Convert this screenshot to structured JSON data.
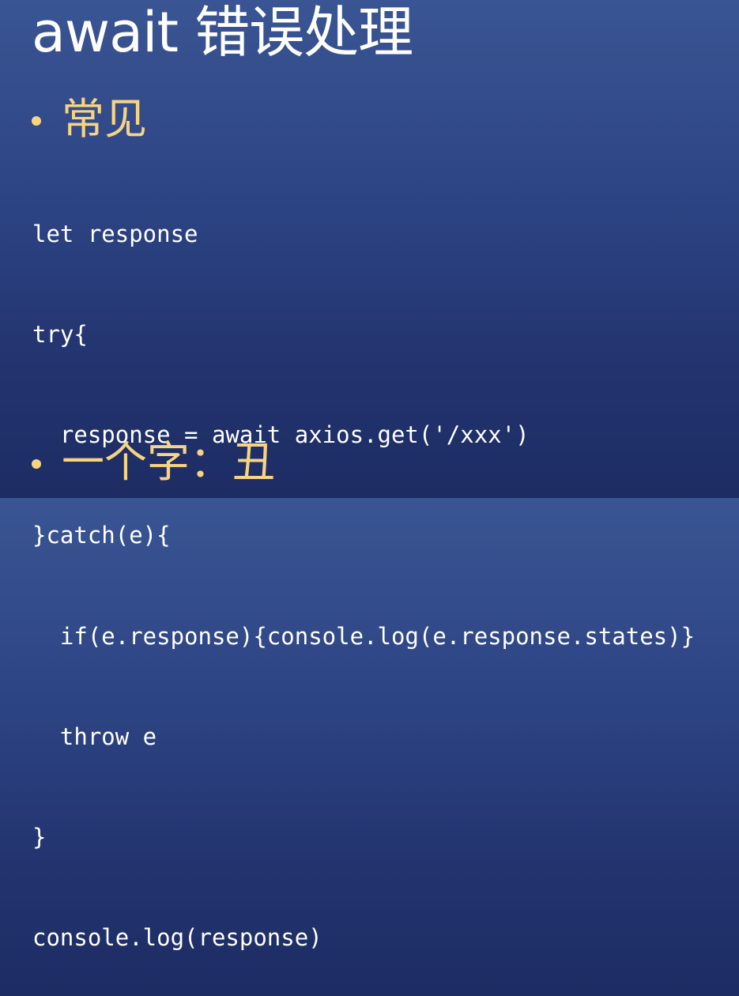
{
  "slide": {
    "title": "await 错误处理",
    "bullets": [
      {
        "text": "常见"
      },
      {
        "text": "一个字：丑"
      }
    ],
    "code_lines": [
      "let response",
      "try{",
      "  response = await axios.get('/xxx')",
      "}catch(e){",
      "  if(e.response){console.log(e.response.states)}",
      "  throw e",
      "}",
      "console.log(response)"
    ]
  },
  "colors": {
    "background_top": "#3a5593",
    "background_bottom": "#1d2c63",
    "title": "#ffffff",
    "bullet": "#f7d482",
    "code": "#ffffff"
  }
}
